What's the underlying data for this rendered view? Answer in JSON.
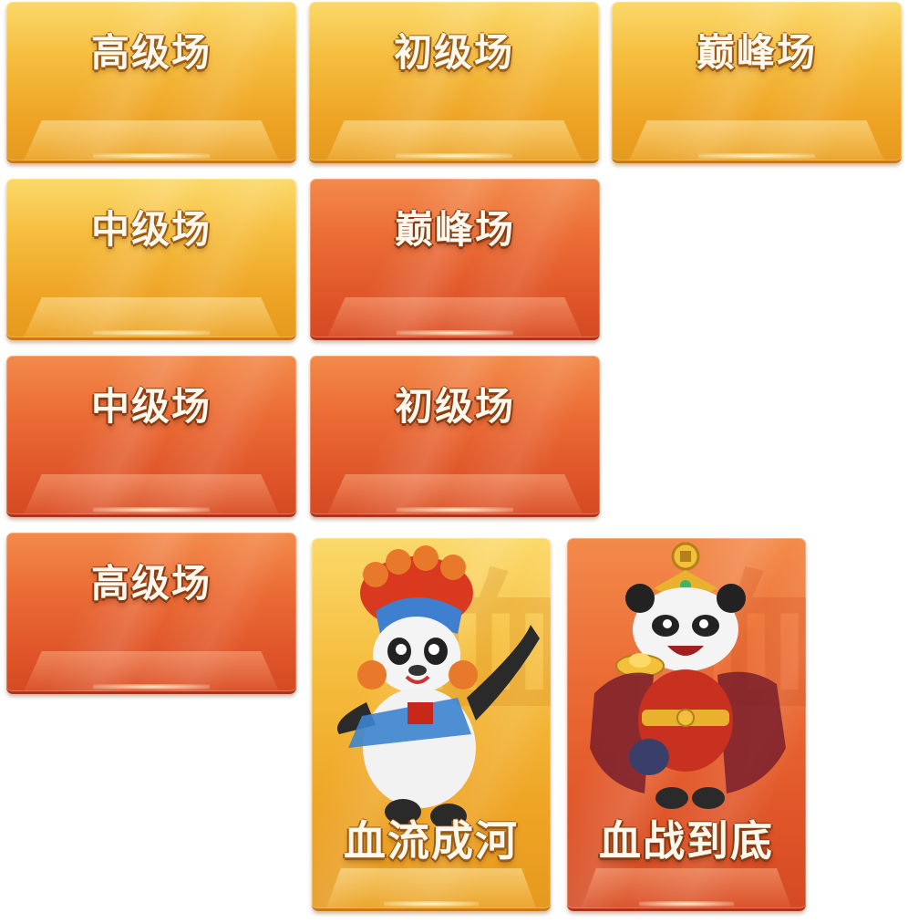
{
  "room_cards": [
    {
      "label": "高级场",
      "theme": "gold"
    },
    {
      "label": "初级场",
      "theme": "gold"
    },
    {
      "label": "巅峰场",
      "theme": "gold"
    },
    {
      "label": "中级场",
      "theme": "gold"
    },
    {
      "label": "巅峰场",
      "theme": "red"
    },
    {
      "label": "中级场",
      "theme": "red"
    },
    {
      "label": "初级场",
      "theme": "red"
    },
    {
      "label": "高级场",
      "theme": "red"
    }
  ],
  "mode_cards": [
    {
      "label": "血流成河",
      "theme": "gold",
      "art": "opera-panda-icon"
    },
    {
      "label": "血战到底",
      "theme": "red",
      "art": "gold-ingot-panda-icon"
    }
  ],
  "colors": {
    "gold_top": "#fbd96a",
    "gold_bottom": "#e59a1f",
    "red_top": "#f38a4a",
    "red_bottom": "#d44a22",
    "label_text": "#fff8ec"
  }
}
